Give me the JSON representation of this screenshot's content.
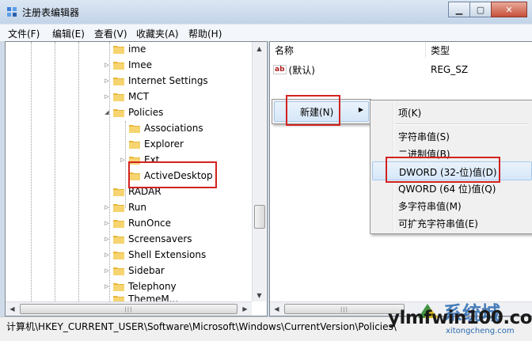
{
  "window": {
    "title": "注册表编辑器",
    "buttons": {
      "minimize": "▁",
      "maximize": "▢",
      "close": "✕"
    }
  },
  "menu": [
    "文件(F)",
    "编辑(E)",
    "查看(V)",
    "收藏夹(A)",
    "帮助(H)"
  ],
  "tree": {
    "items": [
      {
        "label": "ime",
        "expander": ""
      },
      {
        "label": "Imee",
        "expander": "▷"
      },
      {
        "label": "Internet Settings",
        "expander": "▷"
      },
      {
        "label": "MCT",
        "expander": "▷"
      },
      {
        "label": "Policies",
        "expander": "◢"
      },
      {
        "label": "Associations",
        "expander": ""
      },
      {
        "label": "Explorer",
        "expander": ""
      },
      {
        "label": "Ext",
        "expander": "▷"
      },
      {
        "label": "ActiveDesktop",
        "expander": ""
      },
      {
        "label": "RADAR",
        "expander": ""
      },
      {
        "label": "Run",
        "expander": "▷"
      },
      {
        "label": "RunOnce",
        "expander": "▷"
      },
      {
        "label": "Screensavers",
        "expander": "▷"
      },
      {
        "label": "Shell Extensions",
        "expander": "▷"
      },
      {
        "label": "Sidebar",
        "expander": "▷"
      },
      {
        "label": "Telephony",
        "expander": "▷"
      },
      {
        "label": "ThemeM...",
        "expander": ""
      }
    ]
  },
  "list": {
    "columns": {
      "name": "名称",
      "type": "类型"
    },
    "rows": [
      {
        "name": "(默认)",
        "type": "REG_SZ",
        "icon": "ab"
      }
    ]
  },
  "context_menu": {
    "new_label": "新建(N)",
    "submenu_arrow": "▶",
    "submenu": [
      "项(K)",
      "字符串值(S)",
      "二进制值(B)",
      "DWORD (32-位)值(D)",
      "QWORD (64 位)值(Q)",
      "多字符串值(M)",
      "可扩充字符串值(E)"
    ]
  },
  "status_bar": "计算机\\HKEY_CURRENT_USER\\Software\\Microsoft\\Windows\\CurrentVersion\\Policies\\",
  "watermark": {
    "main": "ylmfwin100.com",
    "sub": "xitongcheng.com",
    "logo_text": "系统城"
  },
  "colors": {
    "highlight_box": "#d2231f",
    "menu_hover": "#d6e7f9"
  }
}
